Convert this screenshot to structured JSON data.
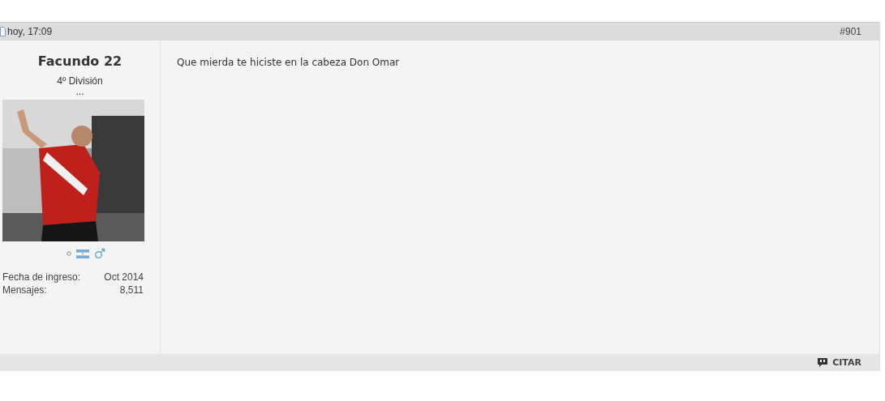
{
  "post": {
    "date": "hoy, 17:09",
    "number": "#901"
  },
  "user": {
    "name": "Facundo 22",
    "rank": "4º División",
    "title": "...",
    "online": false,
    "stats": [
      {
        "label": "Fecha de ingreso:",
        "value": "Oct 2014"
      },
      {
        "label": "Mensajes:",
        "value": "8,511"
      }
    ]
  },
  "message": "Que mierda te hiciste en la cabeza Don Omar",
  "footer": {
    "quote_button": "CITAR"
  }
}
